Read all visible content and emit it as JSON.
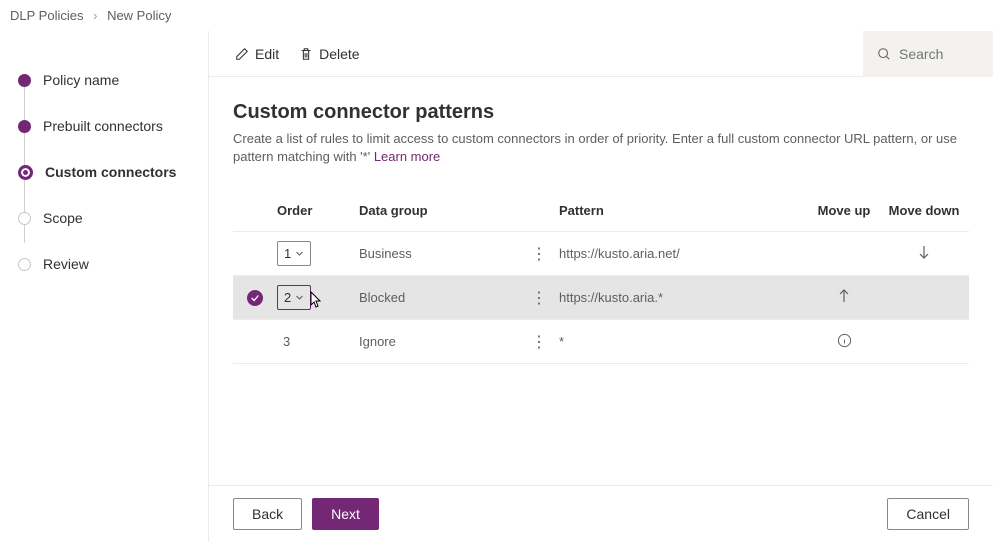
{
  "breadcrumb": {
    "root": "DLP Policies",
    "current": "New Policy"
  },
  "sidebar": {
    "steps": [
      {
        "label": "Policy name",
        "state": "done"
      },
      {
        "label": "Prebuilt connectors",
        "state": "done"
      },
      {
        "label": "Custom connectors",
        "state": "current"
      },
      {
        "label": "Scope",
        "state": "future"
      },
      {
        "label": "Review",
        "state": "future"
      }
    ]
  },
  "toolbar": {
    "edit_label": "Edit",
    "delete_label": "Delete",
    "search_placeholder": "Search"
  },
  "page": {
    "title": "Custom connector patterns",
    "description": "Create a list of rules to limit access to custom connectors in order of priority. Enter a full custom connector URL pattern, or use pattern matching with '*' ",
    "learn_more": "Learn more"
  },
  "table": {
    "headers": {
      "order": "Order",
      "data_group": "Data group",
      "pattern": "Pattern",
      "move_up": "Move up",
      "move_down": "Move down"
    },
    "rows": [
      {
        "order": "1",
        "data_group": "Business",
        "pattern": "https://kusto.aria.net/",
        "selected": false,
        "has_dropdown": true,
        "move_up": false,
        "move_down": true,
        "info": false
      },
      {
        "order": "2",
        "data_group": "Blocked",
        "pattern": "https://kusto.aria.*",
        "selected": true,
        "has_dropdown": true,
        "move_up": true,
        "move_down": false,
        "info": false
      },
      {
        "order": "3",
        "data_group": "Ignore",
        "pattern": "*",
        "selected": false,
        "has_dropdown": false,
        "move_up": false,
        "move_down": false,
        "info": true
      }
    ]
  },
  "footer": {
    "back": "Back",
    "next": "Next",
    "cancel": "Cancel"
  }
}
